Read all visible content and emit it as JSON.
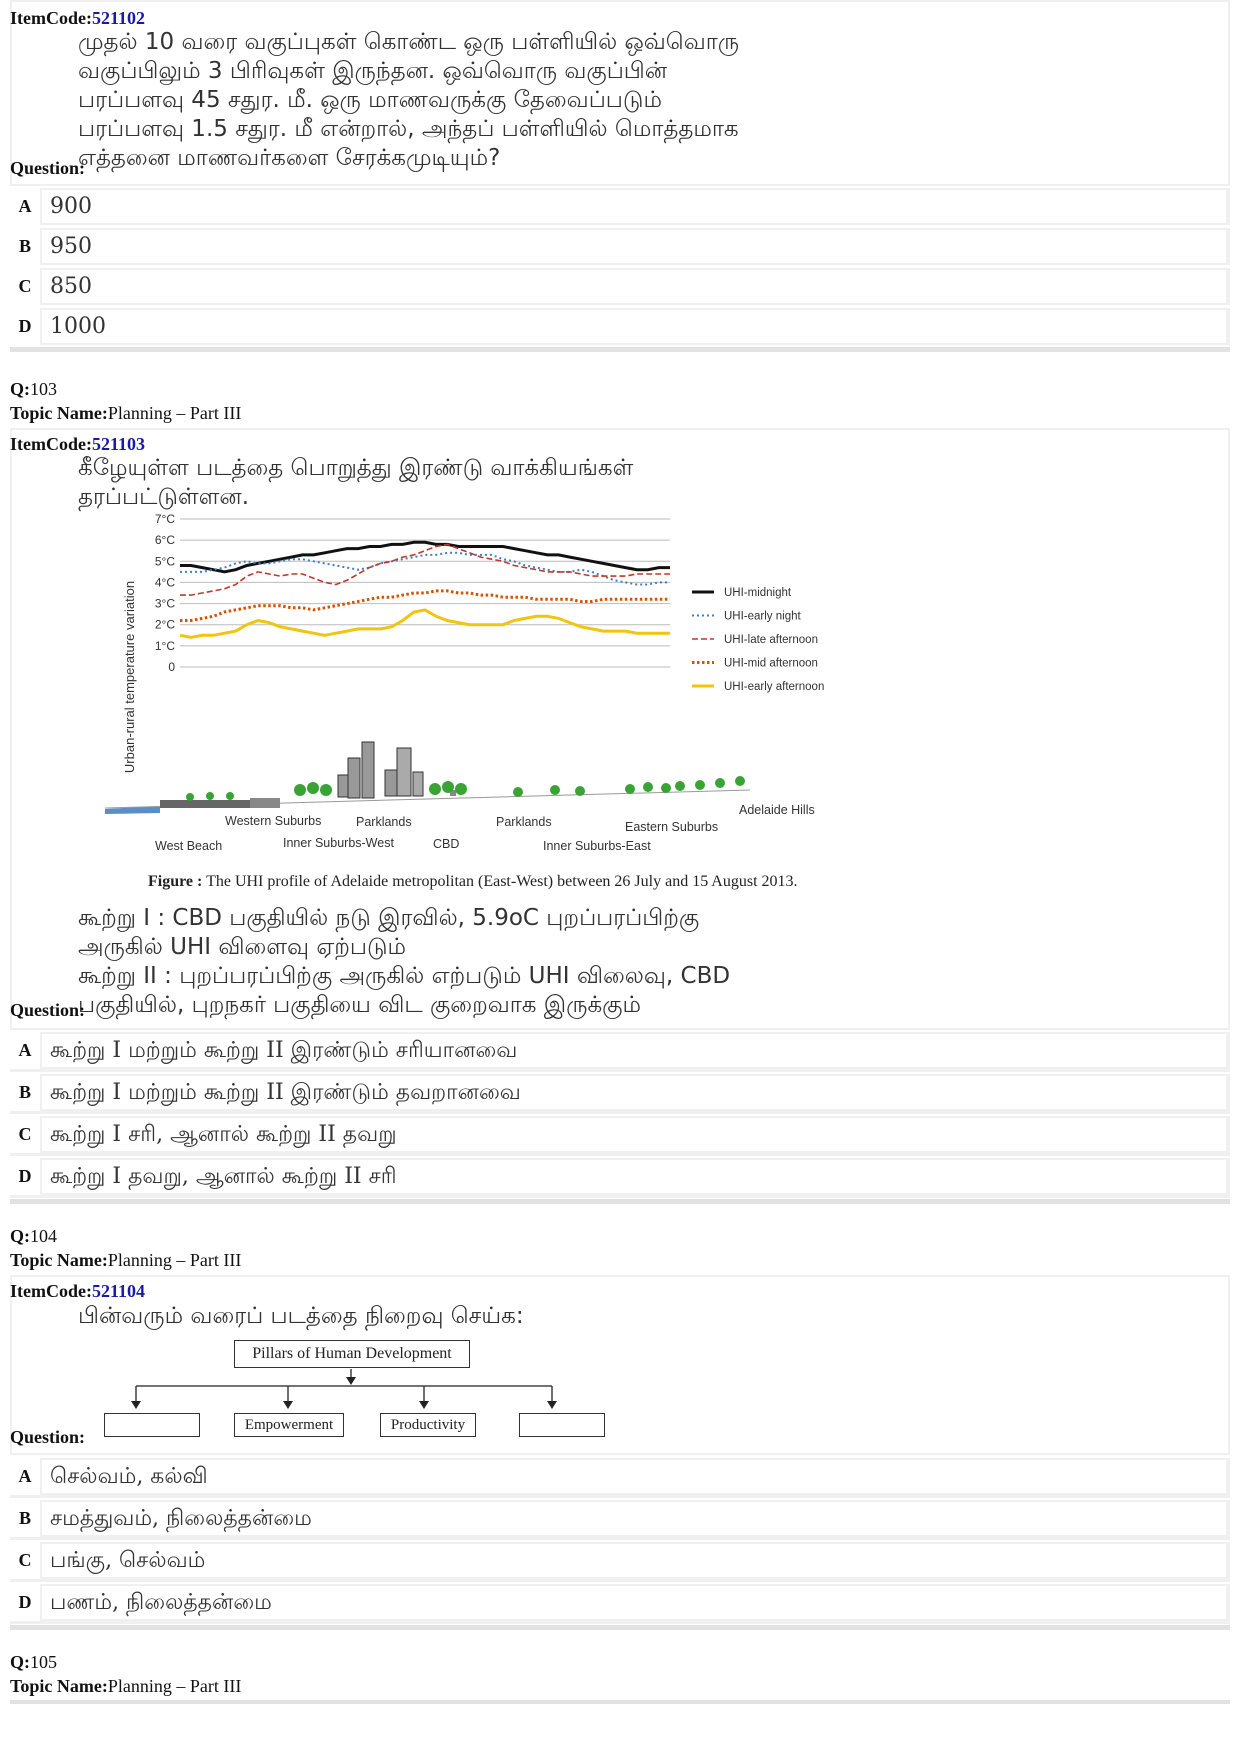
{
  "q102": {
    "itemcode_label": "ItemCode:",
    "itemcode": "521102",
    "question_lines": [
      "முதல் 10 வரை வகுப்புகள் கொண்ட ஒரு பள்ளியில் ஒவ்வொரு",
      "வகுப்பிலும் 3 பிரிவுகள் இருந்தன. ஒவ்வொரு வகுப்பின்",
      "பரப்பளவு 45 சதுர. மீ. ஒரு மாணவருக்கு தேவைப்படும்",
      "பரப்பளவு 1.5 சதுர. மீ என்றால், அந்தப் பள்ளியில் மொத்தமாக",
      "எத்தனை மாணவர்களை சேரக்கமுடியும்?"
    ],
    "question_label": "Question:",
    "options": [
      {
        "letter": "A",
        "text": "900"
      },
      {
        "letter": "B",
        "text": "950"
      },
      {
        "letter": "C",
        "text": "850"
      },
      {
        "letter": "D",
        "text": "1000"
      }
    ]
  },
  "q103": {
    "q_label": "Q:",
    "q_num": "103",
    "topic_label": "Topic Name:",
    "topic": "Planning – Part III",
    "itemcode_label": "ItemCode:",
    "itemcode": "521103",
    "intro_lines": [
      "கீழேயுள்ள படத்தை பொறுத்து இரண்டு வாக்கியங்கள்",
      "தரப்பட்டுள்ளன."
    ],
    "figure_caption_bold": "Figure :",
    "figure_caption": " The UHI profile of Adelaide metropolitan (East-West) between 26 July and 15 August 2013.",
    "statement_lines": [
      "கூற்று I : CBD பகுதியில் நடு இரவில், 5.9oC புறப்பரப்பிற்கு",
      "அருகில் UHI விளைவு ஏற்படும்",
      "கூற்று II : புறப்பரப்பிற்கு அருகில் எற்படும் UHI விலைவு, CBD",
      "பகுதியில், புறநகர் பகுதியை விட குறைவாக இருக்கும்"
    ],
    "question_label": "Question:",
    "options": [
      {
        "letter": "A",
        "text": "கூற்று I மற்றும் கூற்று II இரண்டும் சரியானவை"
      },
      {
        "letter": "B",
        "text": "கூற்று I மற்றும் கூற்று II இரண்டும் தவறானவை"
      },
      {
        "letter": "C",
        "text": "கூற்று I சரி, ஆனால் கூற்று II தவறு"
      },
      {
        "letter": "D",
        "text": "கூற்று I தவறு, ஆனால் கூற்று II சரி"
      }
    ]
  },
  "chart_data": {
    "type": "line",
    "ylabel": "Urban-rural temperature variation",
    "yticks": [
      "0",
      "1°C",
      "2°C",
      "3°C",
      "4°C",
      "5°C",
      "6°C",
      "7°C"
    ],
    "ylim": [
      0,
      7
    ],
    "grid": true,
    "legend_position": "right",
    "x_axis_labels": [
      "West Beach",
      "Western Suburbs",
      "Inner Suburbs-West",
      "Parklands",
      "CBD",
      "Parklands",
      "Inner Suburbs-East",
      "Eastern Suburbs",
      "Adelaide Hills"
    ],
    "x": [
      0,
      1,
      2,
      3,
      4,
      5,
      6,
      7,
      8,
      9,
      10,
      11,
      12,
      13,
      14,
      15,
      16,
      17,
      18,
      19,
      20,
      21,
      22,
      23,
      24,
      25,
      26,
      27,
      28,
      29,
      30,
      31,
      32,
      33,
      34,
      35,
      36,
      37,
      38,
      39,
      40,
      41,
      42,
      43,
      44
    ],
    "series": [
      {
        "name": "UHI-midnight",
        "color": "#111111",
        "dash": "solid",
        "values": [
          4.8,
          4.8,
          4.7,
          4.6,
          4.5,
          4.6,
          4.8,
          4.9,
          5.0,
          5.1,
          5.2,
          5.3,
          5.3,
          5.4,
          5.5,
          5.6,
          5.6,
          5.7,
          5.7,
          5.8,
          5.8,
          5.9,
          5.9,
          5.8,
          5.8,
          5.7,
          5.7,
          5.7,
          5.7,
          5.7,
          5.6,
          5.5,
          5.4,
          5.3,
          5.3,
          5.2,
          5.1,
          5.0,
          4.9,
          4.8,
          4.7,
          4.6,
          4.6,
          4.7,
          4.7
        ]
      },
      {
        "name": "UHI-early night",
        "color": "#3d7fc2",
        "dash": "dot",
        "values": [
          4.5,
          4.5,
          4.5,
          4.6,
          4.7,
          4.9,
          5.0,
          4.9,
          4.9,
          5.0,
          5.1,
          5.1,
          5.0,
          4.9,
          4.8,
          4.7,
          4.6,
          4.7,
          4.9,
          5.0,
          5.1,
          5.2,
          5.3,
          5.3,
          5.4,
          5.4,
          5.3,
          5.3,
          5.3,
          5.1,
          5.0,
          4.8,
          4.7,
          4.6,
          4.5,
          4.5,
          4.6,
          4.5,
          4.3,
          4.1,
          4.0,
          3.9,
          3.9,
          4.0,
          4.0
        ]
      },
      {
        "name": "UHI-late afternoon",
        "color": "#c0392b",
        "dash": "dash",
        "values": [
          3.4,
          3.4,
          3.5,
          3.6,
          3.7,
          3.9,
          4.3,
          4.5,
          4.4,
          4.3,
          4.4,
          4.4,
          4.2,
          4.0,
          3.9,
          4.1,
          4.4,
          4.7,
          4.9,
          5.0,
          5.2,
          5.3,
          5.5,
          5.7,
          5.8,
          5.6,
          5.4,
          5.2,
          5.1,
          5.0,
          4.8,
          4.7,
          4.6,
          4.5,
          4.5,
          4.5,
          4.4,
          4.3,
          4.3,
          4.3,
          4.3,
          4.4,
          4.4,
          4.4,
          4.4
        ]
      },
      {
        "name": "UHI-mid afternoon",
        "color": "#d35400",
        "dash": "dot-heavy",
        "values": [
          2.2,
          2.2,
          2.3,
          2.4,
          2.6,
          2.7,
          2.8,
          2.9,
          2.9,
          2.9,
          2.8,
          2.8,
          2.7,
          2.8,
          2.9,
          3.0,
          3.1,
          3.2,
          3.3,
          3.3,
          3.4,
          3.5,
          3.5,
          3.6,
          3.6,
          3.5,
          3.5,
          3.4,
          3.4,
          3.3,
          3.3,
          3.3,
          3.2,
          3.2,
          3.2,
          3.2,
          3.1,
          3.1,
          3.2,
          3.2,
          3.2,
          3.2,
          3.2,
          3.2,
          3.2
        ]
      },
      {
        "name": "UHI-early afternoon",
        "color": "#f1c40f",
        "dash": "solid",
        "values": [
          1.5,
          1.4,
          1.5,
          1.5,
          1.6,
          1.7,
          2.0,
          2.2,
          2.1,
          1.9,
          1.8,
          1.7,
          1.6,
          1.5,
          1.6,
          1.7,
          1.8,
          1.8,
          1.8,
          1.9,
          2.2,
          2.6,
          2.7,
          2.4,
          2.2,
          2.1,
          2.0,
          2.0,
          2.0,
          2.0,
          2.2,
          2.3,
          2.4,
          2.4,
          2.3,
          2.1,
          1.9,
          1.8,
          1.7,
          1.7,
          1.7,
          1.6,
          1.6,
          1.6,
          1.6
        ]
      }
    ]
  },
  "q104": {
    "q_label": "Q:",
    "q_num": "104",
    "topic_label": "Topic Name:",
    "topic": "Planning – Part III",
    "itemcode_label": "ItemCode:",
    "itemcode": "521104",
    "intro": "பின்வரும் வரைப் படத்தை நிறைவு செய்க:",
    "diagram": {
      "root": "Pillars  of  Human  Development",
      "children": [
        "",
        "Empowerment",
        "Productivity",
        ""
      ]
    },
    "question_label": "Question:",
    "options": [
      {
        "letter": "A",
        "text": "செல்வம், கல்வி"
      },
      {
        "letter": "B",
        "text": "சமத்துவம், நிலைத்தன்மை"
      },
      {
        "letter": "C",
        "text": "பங்கு, செல்வம்"
      },
      {
        "letter": "D",
        "text": "பணம், நிலைத்தன்மை"
      }
    ]
  },
  "q105": {
    "q_label": "Q:",
    "q_num": "105",
    "topic_label": "Topic Name:",
    "topic": "Planning – Part III"
  }
}
